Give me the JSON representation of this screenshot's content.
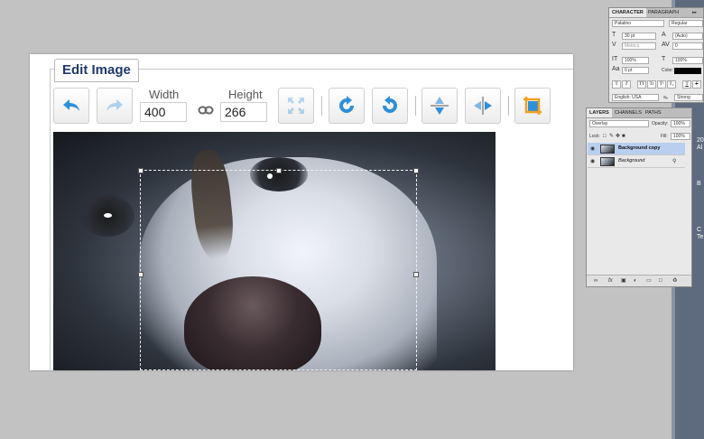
{
  "editor": {
    "title": "Edit Image",
    "width_label": "Width",
    "height_label": "Height",
    "width_value": "400",
    "height_value": "266"
  },
  "character_panel": {
    "tabs": [
      "CHARACTER",
      "PARAGRAPH"
    ],
    "font_family": "Palatino",
    "font_style": "Regular",
    "font_size": "30 pt",
    "leading": "(Auto)",
    "kerning": "Metrics",
    "tracking": "0",
    "vertical_scale": "100%",
    "horizontal_scale": "100%",
    "baseline_shift": "0 pt",
    "color_label": "Color:",
    "language": "English: USA",
    "antialias_label": "aₐ",
    "antialias": "Strong",
    "style_buttons": [
      "T",
      "T",
      "TT",
      "Tr",
      "T¹",
      "T₁",
      "T",
      "F"
    ]
  },
  "layers_panel": {
    "tabs": [
      "LAYERS",
      "CHANNELS",
      "PATHS"
    ],
    "blend_mode": "Overlay",
    "opacity_label": "Opacity:",
    "opacity": "100%",
    "lock_label": "Lock:",
    "fill_label": "Fill:",
    "fill": "100%",
    "layers": [
      {
        "name": "Background copy",
        "selected": true
      },
      {
        "name": "Background",
        "selected": false
      }
    ],
    "footer_icons": [
      "link-icon",
      "fx-icon",
      "mask-icon",
      "adjustment-icon",
      "folder-icon",
      "new-layer-icon",
      "trash-icon"
    ]
  },
  "strip_texts": [
    "20",
    "Al",
    "B",
    "C",
    "Te"
  ]
}
